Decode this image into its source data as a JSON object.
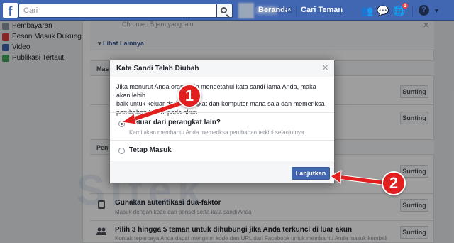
{
  "topbar": {
    "logo": "f",
    "search_placeholder": "Cari",
    "nav": [
      {
        "label": "Beranda",
        "count": "8"
      },
      {
        "label": "Cari Teman"
      }
    ],
    "notification_count": "1",
    "icons": [
      "friends-icon",
      "messages-icon",
      "notifications-icon",
      "help-icon",
      "chevron-down-icon"
    ]
  },
  "sidebar": {
    "items": [
      {
        "label": "Pembayaran",
        "icon": "payments-icon"
      },
      {
        "label": "Pesan Masuk Dukungan",
        "icon": "support-inbox-icon"
      },
      {
        "label": "Video",
        "icon": "video-icon"
      },
      {
        "label": "Publikasi Tertaut",
        "icon": "linked-publications-icon"
      }
    ]
  },
  "settings": {
    "session_info": "Chrome · 5 jam yang lalu",
    "see_more": "Lihat Lainnya",
    "band1_label": "Masu",
    "band2_label": "Peny",
    "edit_label": "Sunting",
    "rows": [
      {
        "title": "Gunakan autentikasi dua-faktor",
        "subtitle": "Masuk dengan kode dari ponsel serta kata sandi Anda"
      },
      {
        "title": "Pilih 3 hingga 5 teman untuk dihubungi jika Anda terkunci di luar akun",
        "subtitle": "Kontak tepercaya Anda dapat mengirim kode dan URL dari Facebook untuk membantu Anda masuk kembali"
      }
    ]
  },
  "dialog": {
    "title": "Kata Sandi Telah Diubah",
    "body_line1": "Jika menurut Anda orang lain mengetahui kata sandi lama Anda, maka akan lebih",
    "body_line2": "baik untuk keluar dari perangkat dan komputer mana saja dan memeriksa",
    "body_line3": "perubahan terkini pada akun.",
    "options": [
      {
        "label": "Keluar dari perangkat lain?",
        "sublabel": "Kami akan membantu Anda memeriksa perubahan terkini selanjutnya.",
        "checked": true
      },
      {
        "label": "Tetap Masuk",
        "checked": false
      }
    ],
    "continue_label": "Lanjutkan"
  },
  "watermark": "Sitek",
  "annotations": [
    {
      "number": "1"
    },
    {
      "number": "2"
    }
  ],
  "colors": {
    "brand_blue": "#4267b2",
    "annotation_red": "#e21f1f",
    "page_bg": "#e9ebee"
  }
}
